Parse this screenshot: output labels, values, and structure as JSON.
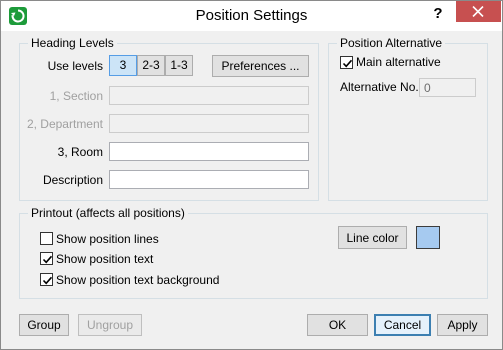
{
  "window": {
    "title": "Position Settings",
    "help_label": "?"
  },
  "heading_levels": {
    "group_title": "Heading Levels",
    "use_levels_label": "Use levels",
    "levels": [
      "3",
      "2-3",
      "1-3"
    ],
    "active_level": "3",
    "preferences_label": "Preferences ...",
    "fields": [
      {
        "label": "1, Section",
        "value": "",
        "enabled": false
      },
      {
        "label": "2, Department",
        "value": "",
        "enabled": false
      },
      {
        "label": "3, Room",
        "value": "",
        "enabled": true
      },
      {
        "label": "Description",
        "value": "",
        "enabled": true
      }
    ]
  },
  "position_alternative": {
    "group_title": "Position Alternative",
    "main_alternative_label": "Main alternative",
    "main_alternative_checked": true,
    "alternative_no_label": "Alternative No.",
    "alternative_no_value": "0"
  },
  "printout": {
    "group_title": "Printout (affects all positions)",
    "options": [
      {
        "label": "Show position lines",
        "checked": false
      },
      {
        "label": "Show position text",
        "checked": true
      },
      {
        "label": "Show position text background",
        "checked": true
      }
    ],
    "line_color_label": "Line color",
    "line_color": "#a6caf0"
  },
  "footer": {
    "group_label": "Group",
    "ungroup_label": "Ungroup",
    "ok_label": "OK",
    "cancel_label": "Cancel",
    "apply_label": "Apply"
  },
  "colors": {
    "title_bar": "#ffffff",
    "close_button": "#c75050",
    "active_level": "#cce4f7",
    "app_icon": "#1d9b3a"
  }
}
